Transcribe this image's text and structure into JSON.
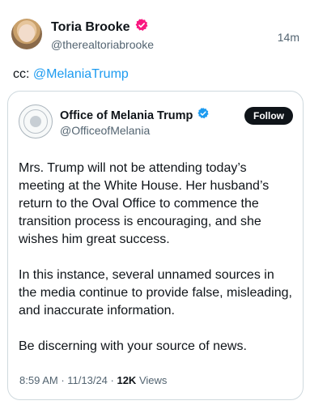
{
  "tweet": {
    "author": {
      "name": "Toria Brooke",
      "handle": "@therealtoriabrooke"
    },
    "time": "14m",
    "text_prefix": "cc: ",
    "mention": "@MelaniaTrump"
  },
  "quoted": {
    "author": {
      "name": "Office of Melania Trump",
      "handle": "@OfficeofMelania"
    },
    "follow_label": "Follow",
    "paragraphs": [
      "Mrs. Trump will not be attending today’s meeting at the White House.  Her husband’s return to the Oval Office to commence the transition process is encouraging, and she wishes him great success.",
      "In this instance, several unnamed sources in the media continue to provide false, misleading, and inaccurate information.",
      "Be discerning with your source of news."
    ],
    "meta": {
      "time": "8:59 AM",
      "date": "11/13/24",
      "separator": " · ",
      "views_count": "12K",
      "views_label": " Views"
    }
  },
  "colors": {
    "verified_pink": "#f91880",
    "verified_blue": "#1d9bf0",
    "mention": "#1d9bf0",
    "button_bg": "#0f1419"
  },
  "icons": {
    "author_badge": "verified-badge-pink-icon",
    "quoted_badge": "verified-badge-blue-icon",
    "quoted_avatar": "presidential-seal-icon"
  }
}
